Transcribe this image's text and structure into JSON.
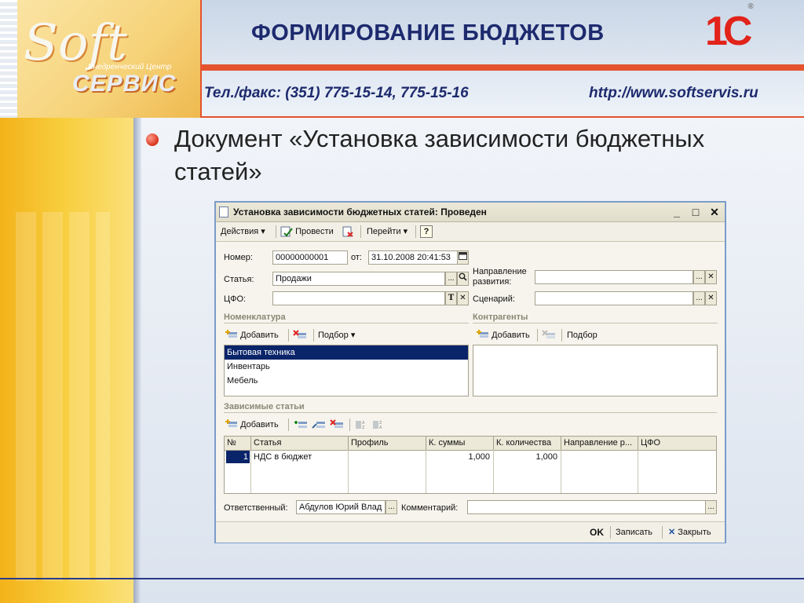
{
  "slide": {
    "title": "ФОРМИРОВАНИЕ БЮДЖЕТОВ",
    "phone": "Тел./факс: (351) 775-15-14, 775-15-16",
    "site": "http://www.softservis.ru",
    "logo_soft": "Soft",
    "logo_center": "Внедренческий Центр",
    "logo_servis": "СЕРВИС",
    "brand": "1С",
    "brand_mark": "®",
    "bullet": "Документ «Установка зависимости бюджетных статей»"
  },
  "window": {
    "title": "Установка зависимости бюджетных статей: Проведен",
    "controls": {
      "minimize": "_",
      "maximize": "□",
      "close": "✕"
    },
    "toolbar": {
      "actions": "Действия",
      "post": "Провести",
      "goto": "Перейти",
      "help": "?",
      "dropdown_arrow": "▾"
    },
    "header": {
      "number_label": "Номер:",
      "number_value": "00000000001",
      "date_label": "от:",
      "date_value": "31.10.2008 20:41:53",
      "article_label": "Статья:",
      "article_value": "Продажи",
      "cfo_label": "ЦФО:",
      "direction_label": "Направление развития:",
      "direction_value": "",
      "scenario_label": "Сценарий:",
      "scenario_value": "",
      "ellipsis": "...",
      "clear": "✕",
      "type_t": "T",
      "search_glyph": "🔍"
    },
    "nomenclature": {
      "title": "Номенклатура",
      "add": "Добавить",
      "pick": "Подбор",
      "items": [
        "Бытовая техника",
        "Инвентарь",
        "Мебель"
      ]
    },
    "contractors": {
      "title": "Контрагенты",
      "add": "Добавить",
      "pick": "Подбор"
    },
    "dependent": {
      "title": "Зависимые статьи",
      "add": "Добавить",
      "columns": [
        "№",
        "Статья",
        "Профиль",
        "К. суммы",
        "К. количества",
        "Направление р...",
        "ЦФО"
      ],
      "rows": [
        {
          "n": "1",
          "article": "НДС в бюджет",
          "profile": "",
          "k_sum": "1,000",
          "k_qty": "1,000",
          "direction": "",
          "cfo": ""
        }
      ]
    },
    "responsible_label": "Ответственный:",
    "responsible_value": "Абдулов Юрий Влад",
    "comment_label": "Комментарий:",
    "comment_value": "",
    "footer": {
      "ok": "OK",
      "save": "Записать",
      "close": "Закрыть"
    },
    "colors": {
      "selection": "#0a246a",
      "window_border": "#7c9bc9",
      "accent_red": "#e4532e",
      "title_blue": "#1d2a6e"
    }
  }
}
